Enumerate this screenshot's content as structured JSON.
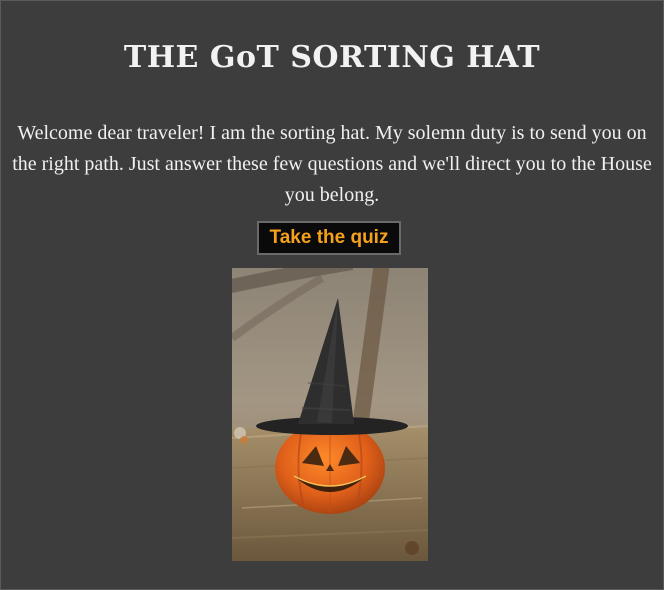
{
  "page": {
    "title": "THE GoT SORTING HAT",
    "intro": "Welcome dear traveler! I am the sorting hat. My solemn duty is to send you on the right path. Just answer these few questions and we'll direct you to the House you belong.",
    "quiz_button_label": "Take the quiz"
  },
  "image": {
    "subject": "carved jack-o-lantern pumpkin wearing a black witch hat on a hay bale"
  },
  "colors": {
    "background": "#3d3d3d",
    "button_background": "#0a0a0a",
    "button_text": "#f6a11b",
    "text": "#f0f0f0"
  }
}
